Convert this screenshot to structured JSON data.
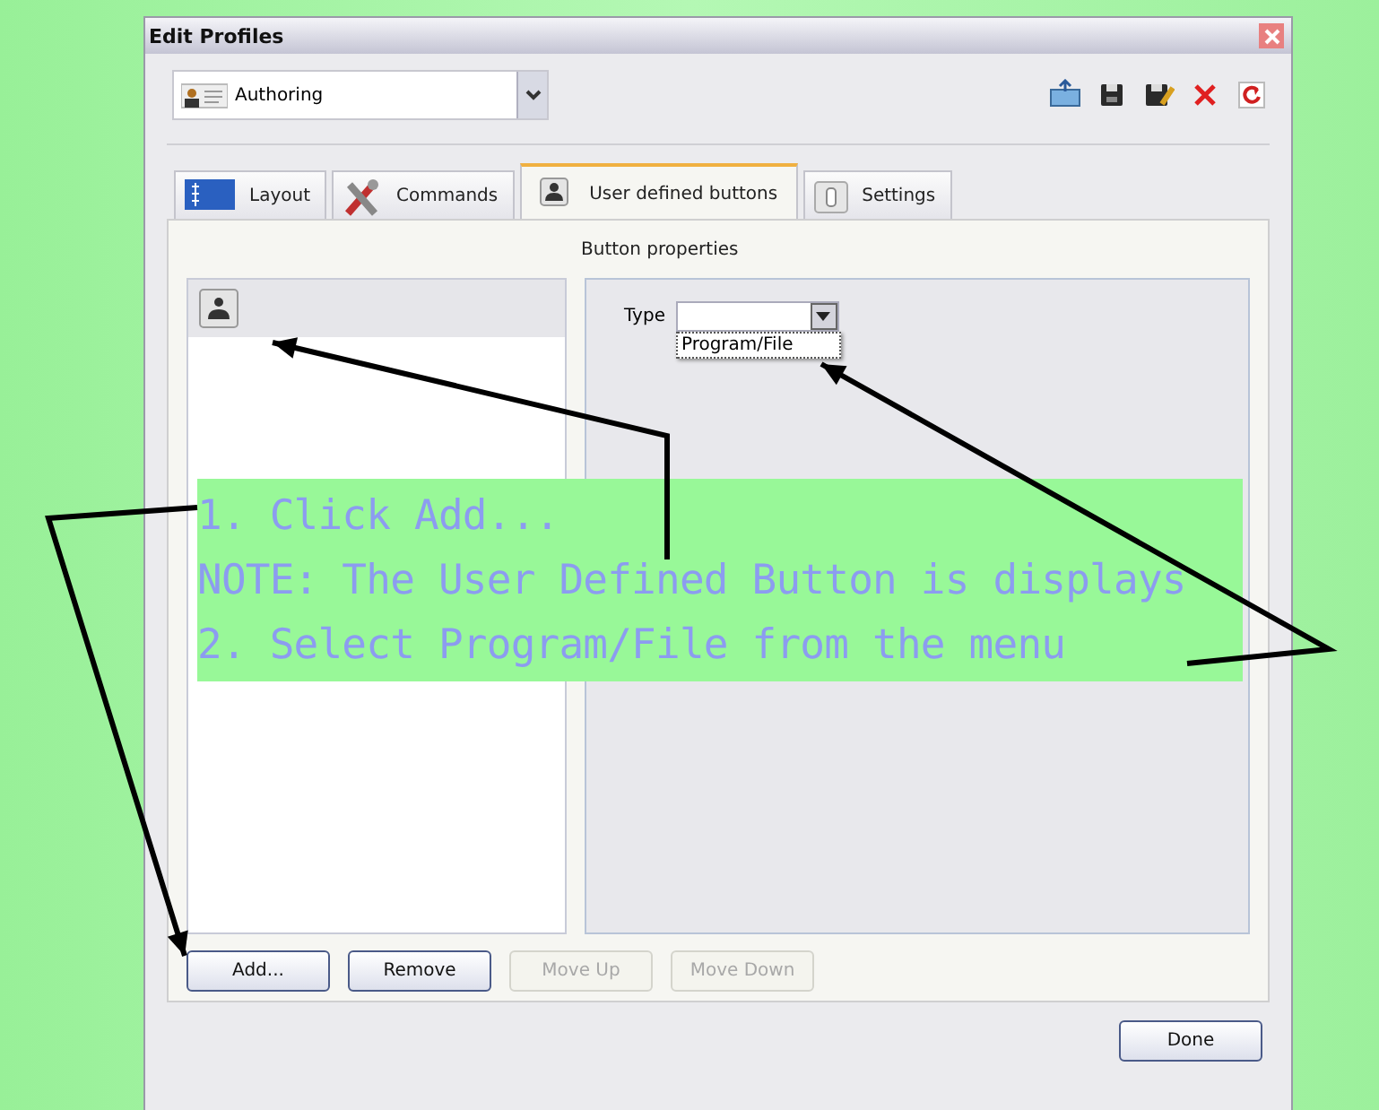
{
  "window": {
    "title": "Edit Profiles"
  },
  "profile": {
    "value": "Authoring"
  },
  "tabs": [
    {
      "label": "Layout",
      "kind": "layout",
      "selected": false
    },
    {
      "label": "Commands",
      "kind": "commands",
      "selected": false
    },
    {
      "label": "User defined buttons",
      "kind": "user",
      "selected": true
    },
    {
      "label": "Settings",
      "kind": "settings",
      "selected": false
    }
  ],
  "section_label": "Button properties",
  "button_list": [
    {
      "selected": true
    }
  ],
  "type_field": {
    "label": "Type",
    "menu_options": [
      "Program/File"
    ]
  },
  "list_buttons": [
    {
      "label": "Add...",
      "disabled": false
    },
    {
      "label": "Remove",
      "disabled": false
    },
    {
      "label": "Move Up",
      "disabled": true
    },
    {
      "label": "Move Down",
      "disabled": true
    }
  ],
  "done_button": "Done",
  "annotation": {
    "lines": [
      "1. Click Add...",
      "NOTE: The User Defined Button is displays",
      "2. Select Program/File from the menu"
    ]
  }
}
